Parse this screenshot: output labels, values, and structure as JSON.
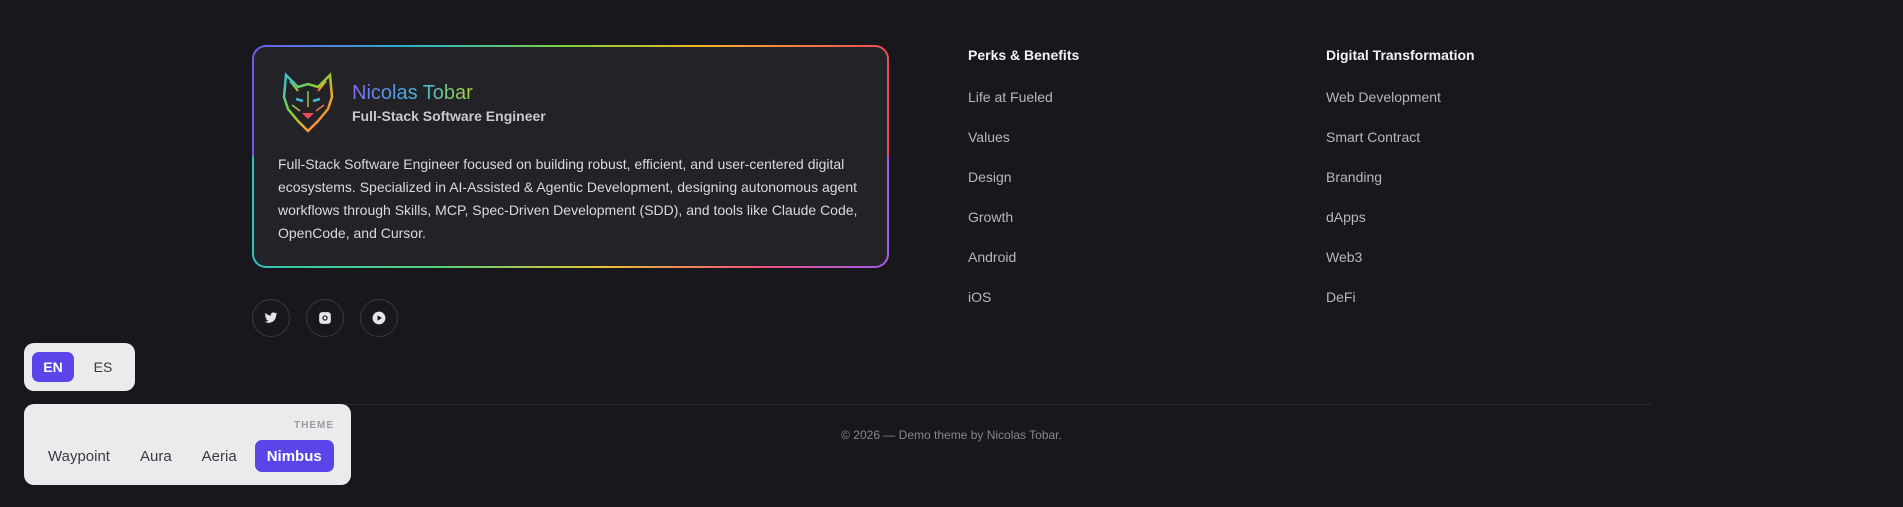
{
  "profile": {
    "name": "Nicolas Tobar",
    "role": "Full-Stack Software Engineer",
    "bio": "Full-Stack Software Engineer focused on building robust, efficient, and user-centered digital ecosystems. Specialized in AI-Assisted & Agentic Development, designing autonomous agent workflows through Skills, MCP, Spec-Driven Development (SDD), and tools like Claude Code, OpenCode, and Cursor.",
    "logo_icon": "wolf-logo-icon"
  },
  "socials": [
    {
      "icon": "twitter-icon"
    },
    {
      "icon": "instagram-icon"
    },
    {
      "icon": "play-circle-icon"
    }
  ],
  "columns": [
    {
      "title": "Perks & Benefits",
      "links": [
        "Life at Fueled",
        "Values",
        "Design",
        "Growth",
        "Android",
        "iOS"
      ]
    },
    {
      "title": "Digital Transformation",
      "links": [
        "Web Development",
        "Smart Contract",
        "Branding",
        "dApps",
        "Web3",
        "DeFi"
      ]
    }
  ],
  "copyright": "© 2026 — Demo theme by Nicolas Tobar.",
  "language": {
    "options": [
      "EN",
      "ES"
    ],
    "selected": "EN"
  },
  "theme": {
    "label": "THEME",
    "options": [
      "Waypoint",
      "Aura",
      "Aeria",
      "Nimbus"
    ],
    "selected": "Nimbus"
  },
  "colors": {
    "background": "#18171b",
    "card": "#232227",
    "accent": "#5b45e8"
  }
}
